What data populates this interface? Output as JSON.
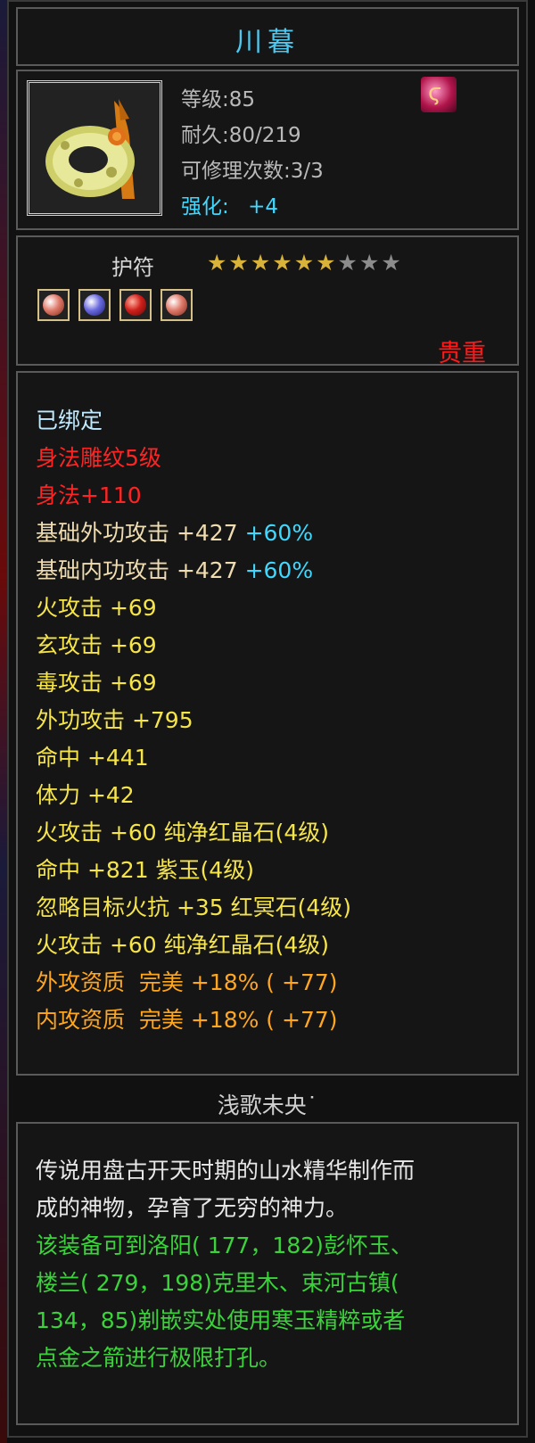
{
  "item": {
    "name": "川暮",
    "icon": "jade-ring-pendant-icon",
    "badge_icon": "phoenix-feather-icon",
    "level": "等级:85",
    "durability": "耐久:80/219",
    "repair": "可修理次数:3/3",
    "enhance_label": "强化:",
    "enhance_value": "+4"
  },
  "category": {
    "label": "护符",
    "stars_total": 9,
    "stars_filled": 6
  },
  "gems": [
    {
      "color": "#e07a6a"
    },
    {
      "color": "#6a6ae0"
    },
    {
      "color": "#d0201a"
    },
    {
      "color": "#e07a6a"
    }
  ],
  "rarity": "贵重",
  "attributes": {
    "bound": "已绑定",
    "carve": "身法雕纹5级",
    "agility": "身法+110",
    "line1_main": "基础外功攻击 +427 ",
    "line1_pct": "+60%",
    "line2_main": "基础内功攻击 +427 ",
    "line2_pct": "+60%",
    "line3": "火攻击 +69",
    "line4": "玄攻击 +69",
    "line5": "毒攻击 +69",
    "line6": "外功攻击 +795",
    "line7": "命中 +441",
    "line8": "体力 +42",
    "gem1": "火攻击 +60 纯净红晶石(4级)",
    "gem2": "命中 +821 紫玉(4级)",
    "gem3": "忽略目标火抗 +35 红冥石(4级)",
    "gem4": "火攻击 +60 纯净红晶石(4级)",
    "apt1": "外攻资质  完美 +18% ( +77)",
    "apt2": "内攻资质  完美 +18% ( +77)"
  },
  "maker": "浅歌未央˙",
  "lore": {
    "desc1": "传说用盘古开天时期的山水精华制作而",
    "desc2": "成的神物，孕育了无穷的神力。",
    "hint1": "该装备可到洛阳( 177，182)彭怀玉、",
    "hint2": "楼兰( 279，198)克里木、束河古镇(",
    "hint3": "134，85)剃嵌实处使用寒玉精粹或者",
    "hint4": "点金之箭进行极限打孔。"
  },
  "colors": {
    "title": "#4fc8f0",
    "rarity": "#ff1a1a",
    "lore_green": "#3cd23c",
    "aptitude": "#ffa621"
  }
}
